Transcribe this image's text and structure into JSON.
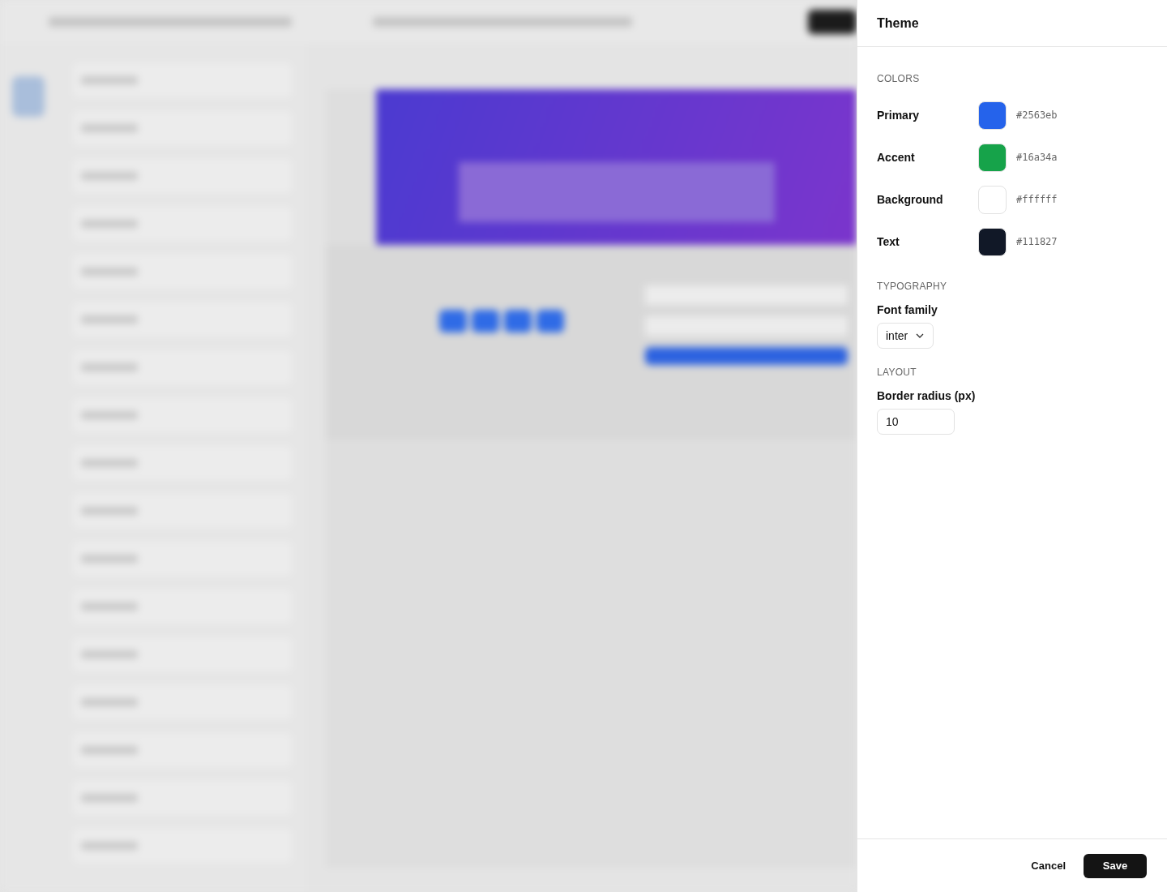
{
  "panel": {
    "title": "Theme",
    "sections": [
      {
        "kind": "colors",
        "heading": "COLORS",
        "items": [
          {
            "label": "Primary",
            "color": "#2563eb",
            "value": "#2563eb"
          },
          {
            "label": "Accent",
            "color": "#16a34a",
            "value": "#16a34a"
          },
          {
            "label": "Background",
            "color": "#ffffff",
            "value": "#ffffff"
          },
          {
            "label": "Text",
            "color": "#111827",
            "value": "#111827"
          }
        ]
      },
      {
        "kind": "select",
        "heading": "TYPOGRAPHY",
        "label": "Font family",
        "value": "inter"
      },
      {
        "kind": "number",
        "heading": "LAYOUT",
        "label": "Border radius (px)",
        "value": "10"
      }
    ],
    "buttons": [
      {
        "label": "Cancel",
        "kind": "secondary"
      },
      {
        "label": "Save",
        "kind": "primary"
      }
    ]
  }
}
